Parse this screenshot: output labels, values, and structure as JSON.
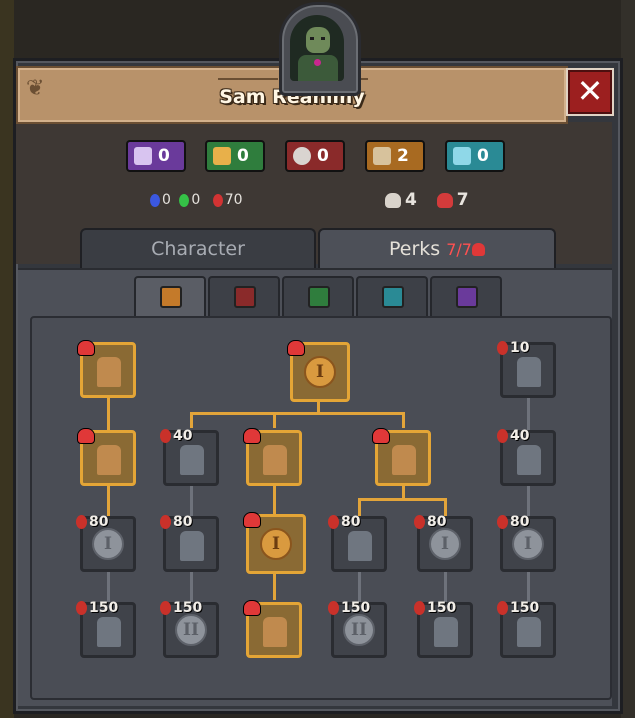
{
  "character": {
    "name": "Sam Reanimy"
  },
  "close_label": "✕",
  "resources": [
    {
      "color": "purple",
      "icon": "skull-icon",
      "value": "0"
    },
    {
      "color": "green",
      "icon": "bread-icon",
      "value": "0"
    },
    {
      "color": "red",
      "icon": "gear-icon",
      "value": "0"
    },
    {
      "color": "orange",
      "icon": "hammer-icon",
      "value": "2"
    },
    {
      "color": "teal",
      "icon": "book-icon",
      "value": "0"
    }
  ],
  "gems": {
    "blue": "0",
    "green": "0",
    "red": "70"
  },
  "skulls": {
    "white": "4",
    "red": "7"
  },
  "tabs": {
    "character": "Character",
    "perks": "Perks",
    "perks_count": "7/7"
  },
  "categories": [
    "hammer-icon",
    "gear-icon",
    "bread-icon",
    "book-icon",
    "skull-icon"
  ],
  "perks": {
    "c1r1": {
      "cost": ""
    },
    "c1r2": {
      "cost": ""
    },
    "c1r3": {
      "cost": "80"
    },
    "c1r4": {
      "cost": "150"
    },
    "c2r2": {
      "cost": "40"
    },
    "c2r3": {
      "cost": "80"
    },
    "c2r4": {
      "cost": "150"
    },
    "root": {
      "label": "I"
    },
    "c3r2": {
      "cost": ""
    },
    "c3r3": {
      "label": "I"
    },
    "c3r4": {
      "cost": ""
    },
    "c4r2": {
      "cost": ""
    },
    "c4r3": {
      "cost": "80"
    },
    "c4r4": {
      "cost": "150",
      "label": "II"
    },
    "c5r3": {
      "cost": "80",
      "label": "I"
    },
    "c5r4": {
      "cost": "150"
    },
    "c6r1": {
      "cost": "10"
    },
    "c6r2": {
      "cost": "40"
    },
    "c6r3": {
      "cost": "80",
      "label": "I"
    },
    "c6r4": {
      "cost": "150"
    },
    "c1r3_label": "I",
    "c2r4_label": "II"
  }
}
